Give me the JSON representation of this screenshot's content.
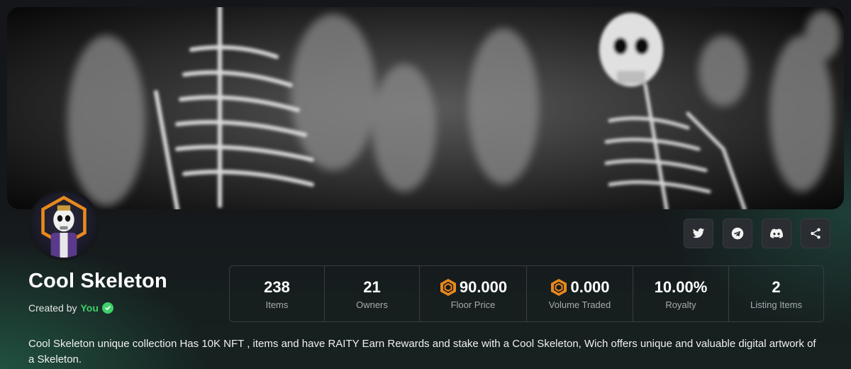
{
  "collection": {
    "name": "Cool Skeleton",
    "created_by_label": "Created by",
    "creator_name": "You",
    "description": "Cool Skeleton unique collection Has 10K NFT , items and have RAITY Earn Rewards and stake with a Cool Skeleton, Wich offers unique and valuable digital artwork of a Skeleton."
  },
  "socials": [
    {
      "icon": "twitter-icon"
    },
    {
      "icon": "telegram-icon"
    },
    {
      "icon": "discord-icon"
    },
    {
      "icon": "share-icon"
    }
  ],
  "stats": [
    {
      "value": "238",
      "label": "Items"
    },
    {
      "value": "21",
      "label": "Owners"
    },
    {
      "value": "90.000",
      "label": "Floor Price",
      "icon": "coin-icon"
    },
    {
      "value": "0.000",
      "label": "Volume Traded",
      "icon": "coin-icon"
    },
    {
      "value": "10.00%",
      "label": "Royalty"
    },
    {
      "value": "2",
      "label": "Listing Items"
    }
  ],
  "colors": {
    "accent_green": "#3fd06a",
    "coin_orange": "#e8891c",
    "background": "#15181b"
  }
}
